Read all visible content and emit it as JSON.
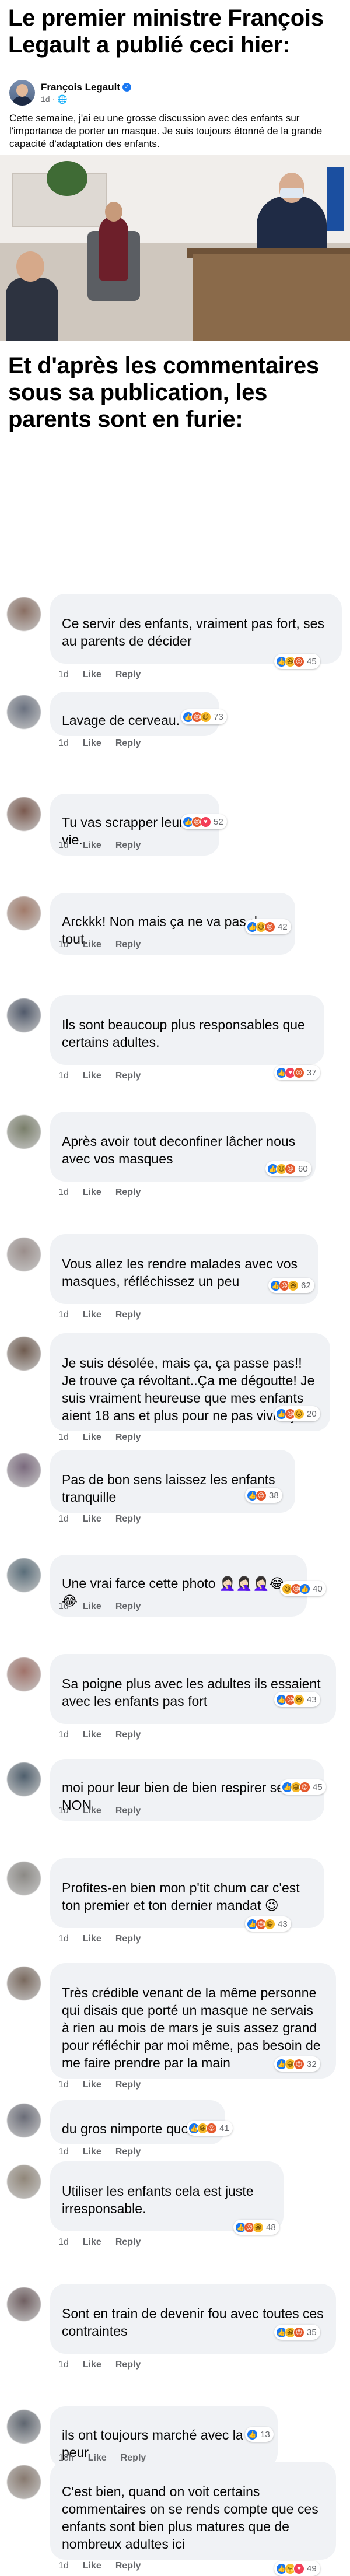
{
  "headline_top": "Le premier ministre François Legault a publié ceci hier:",
  "post": {
    "author": "François Legault",
    "verified_mark": "✓",
    "time": "1d",
    "privacy_icon": "globe-icon",
    "text": "Cette semaine, j'ai eu une grosse discussion avec des enfants sur l'importance de porter un masque. Je suis toujours étonné de la grande capacité d'adaptation des enfants."
  },
  "headline_mid": "Et d'après les commentaires sous sa publication, les parents sont en furie:",
  "labels": {
    "like": "Like",
    "reply": "Reply"
  },
  "comments": [
    {
      "text": "Ce servir des enfants, vraiment pas fort, ses au parents de décider",
      "time": "1d",
      "reactions": [
        "like",
        "haha",
        "angry"
      ],
      "count": "45"
    },
    {
      "text": "Lavage de cerveau.",
      "time": "1d",
      "reactions": [
        "like",
        "angry",
        "haha"
      ],
      "count": "73"
    },
    {
      "text": "Tu vas scrapper leur vie.",
      "time": "1d",
      "reactions": [
        "like",
        "angry",
        "love"
      ],
      "count": "52"
    },
    {
      "text": "Arckkk! Non mais ça ne va pas du tout.",
      "time": "1d",
      "reactions": [
        "like",
        "haha",
        "angry"
      ],
      "count": "42"
    },
    {
      "text": "Ils sont beaucoup plus responsables que certains adultes.",
      "time": "1d",
      "reactions": [
        "like",
        "love",
        "angry"
      ],
      "count": "37"
    },
    {
      "text": "Après avoir tout deconfiner lâcher nous avec vos masques",
      "time": "1d",
      "reactions": [
        "like",
        "haha",
        "angry"
      ],
      "count": "60"
    },
    {
      "text": "Vous allez les rendre malades avec vos masques, réfléchissez un peu",
      "time": "1d",
      "reactions": [
        "like",
        "angry",
        "haha"
      ],
      "count": "62"
    },
    {
      "text": "Je suis désolée, mais ça, ça passe pas!! Je trouve ça révoltant..Ça  me dégoutte! Je suis vraiment heureuse que mes enfants aient 18 ans et plus pour ne pas vivre ça...",
      "time": "1d",
      "reactions": [
        "like",
        "angry",
        "wow"
      ],
      "count": "20"
    },
    {
      "text": "Pas de bon sens laissez les enfants tranquille",
      "time": "1d",
      "reactions": [
        "like",
        "angry"
      ],
      "count": "38"
    },
    {
      "text": "Une vrai farce cette photo 🤦🏻‍♀️🤦🏻‍♀️🤦🏻‍♀️😂😂",
      "time": "1d",
      "reactions": [
        "haha",
        "angry",
        "like"
      ],
      "count": "40"
    },
    {
      "text": "Sa poigne plus avec les adultes ils essaient avec les enfants pas fort",
      "time": "1d",
      "reactions": [
        "like",
        "angry",
        "haha"
      ],
      "count": "43"
    },
    {
      "text": "moi pour leur bien de bien respirer ses NON",
      "time": "1d",
      "reactions": [
        "like",
        "haha",
        "angry"
      ],
      "count": "45"
    },
    {
      "text": "Profites-en bien mon p'tit chum car c'est ton premier et ton dernier mandat 😉",
      "time": "1d",
      "reactions": [
        "like",
        "angry",
        "haha"
      ],
      "count": "43"
    },
    {
      "text": "Très crédible venant de la même personne qui disais que porté un masque ne servais à rien au mois de mars je suis assez grand pour réfléchir par moi même, pas besoin de me faire prendre par la main",
      "time": "1d",
      "reactions": [
        "like",
        "haha",
        "angry"
      ],
      "count": "32"
    },
    {
      "text": "du gros nimporte quoi",
      "time": "1d",
      "reactions": [
        "like",
        "haha",
        "angry"
      ],
      "count": "41"
    },
    {
      "text": "Utiliser les enfants cela est juste irresponsable.",
      "time": "1d",
      "reactions": [
        "like",
        "angry",
        "haha"
      ],
      "count": "48"
    },
    {
      "text": "Sont en train de devenir fou avec toutes ces contraintes",
      "time": "1d",
      "reactions": [
        "like",
        "haha",
        "angry"
      ],
      "count": "35"
    },
    {
      "text": "ils ont toujours marché avec la peur",
      "time": "18h",
      "reactions": [
        "like"
      ],
      "count": "13"
    },
    {
      "text": "C'est bien, quand on voit certains commentaires on se rends compte que ces enfants sont bien plus matures que de nombreux adultes ici",
      "time": "1d",
      "reactions": [
        "like",
        "care",
        "love"
      ],
      "count": "49"
    }
  ]
}
